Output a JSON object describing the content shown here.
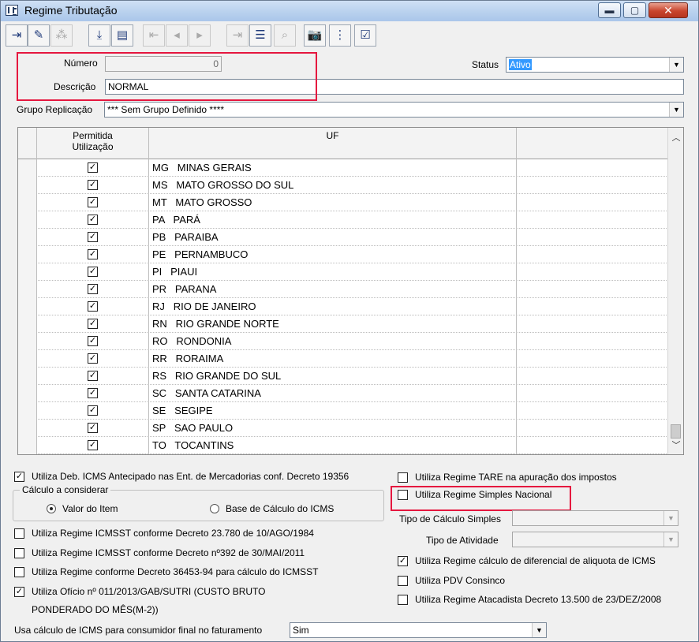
{
  "window": {
    "title": "Regime Tributação",
    "minimize": "▬",
    "maximize": "▢",
    "close": "✕"
  },
  "toolbar": {
    "buttons": [
      {
        "name": "exit-icon",
        "glyph": "⇥",
        "enabled": true
      },
      {
        "name": "eraser-icon",
        "glyph": "✎",
        "enabled": true
      },
      {
        "name": "sitemap-icon",
        "glyph": "⁂",
        "enabled": false
      },
      {
        "name": "save-icon",
        "glyph": "⤓",
        "enabled": true
      },
      {
        "name": "delete-icon",
        "glyph": "▤",
        "enabled": true
      },
      {
        "name": "first-record-icon",
        "glyph": "⇤",
        "enabled": false
      },
      {
        "name": "previous-record-icon",
        "glyph": "◂",
        "enabled": false
      },
      {
        "name": "next-record-icon",
        "glyph": "▸",
        "enabled": false
      },
      {
        "name": "last-record-icon",
        "glyph": "⇥",
        "enabled": false
      },
      {
        "name": "list-icon",
        "glyph": "☰",
        "enabled": true
      },
      {
        "name": "search-icon",
        "glyph": "⌕",
        "enabled": false
      },
      {
        "name": "camera-icon",
        "glyph": "📷",
        "enabled": true
      },
      {
        "name": "tree-icon",
        "glyph": "⋮",
        "enabled": true
      },
      {
        "name": "checklist-icon",
        "glyph": "☑",
        "enabled": true
      }
    ]
  },
  "form": {
    "numero_label": "Número",
    "numero_value": "0",
    "descricao_label": "Descrição",
    "descricao_value": "NORMAL",
    "status_label": "Status",
    "status_value": "Ativo",
    "grupo_label": "Grupo Replicação",
    "grupo_value": "*** Sem Grupo Definido ****"
  },
  "grid": {
    "headers": {
      "permitida": "Permitida\nUtilização",
      "uf": "UF"
    },
    "rows": [
      {
        "uf": "MG   MINAS GERAIS",
        "checked": true
      },
      {
        "uf": "MS   MATO GROSSO DO SUL",
        "checked": true
      },
      {
        "uf": "MT   MATO GROSSO",
        "checked": true
      },
      {
        "uf": "PA   PARÁ",
        "checked": true
      },
      {
        "uf": "PB   PARAIBA",
        "checked": true
      },
      {
        "uf": "PE   PERNAMBUCO",
        "checked": true
      },
      {
        "uf": "PI   PIAUI",
        "checked": true
      },
      {
        "uf": "PR   PARANA",
        "checked": true
      },
      {
        "uf": "RJ   RIO DE JANEIRO",
        "checked": true
      },
      {
        "uf": "RN   RIO GRANDE NORTE",
        "checked": true
      },
      {
        "uf": "RO   RONDONIA",
        "checked": true
      },
      {
        "uf": "RR   RORAIMA",
        "checked": true
      },
      {
        "uf": "RS   RIO GRANDE DO SUL",
        "checked": true
      },
      {
        "uf": "SC   SANTA CATARINA",
        "checked": true
      },
      {
        "uf": "SE   SEGIPE",
        "checked": true
      },
      {
        "uf": "SP   SAO PAULO",
        "checked": true
      },
      {
        "uf": "TO   TOCANTINS",
        "checked": true
      }
    ]
  },
  "options_left": {
    "deb_icms": {
      "label": "Utiliza Deb. ICMS Antecipado nas Ent. de Mercadorias conf. Decreto 19356",
      "checked": true
    },
    "calculo_title": "Cálculo a considerar",
    "radio_valor": "Valor do Item",
    "radio_base": "Base de Cálculo do ICMS",
    "icmsst_23780": {
      "label": "Utiliza Regime ICMSST conforme Decreto 23.780 de 10/AGO/1984",
      "checked": false
    },
    "icmsst_392": {
      "label": "Utiliza Regime ICMSST conforme Decreto nº392 de 30/MAI/2011",
      "checked": false
    },
    "decreto_36453": {
      "label": "Utiliza Regime conforme Decreto 36453-94 para cálculo do ICMSST",
      "checked": false
    },
    "oficio": {
      "label_line1": "Utiliza Ofício nº 011/2013/GAB/SUTRI (CUSTO BRUTO",
      "label_line2": "PONDERADO DO MÊS(M-2))",
      "checked": true
    },
    "consumidor_label": "Usa cálculo de ICMS para consumidor final no faturamento",
    "consumidor_value": "Sim"
  },
  "options_right": {
    "tare": {
      "label": "Utiliza Regime TARE na apuração dos impostos",
      "checked": false
    },
    "simples": {
      "label": "Utiliza Regime Simples Nacional",
      "checked": false
    },
    "tipo_calculo_label": "Tipo de Cálculo Simples",
    "tipo_atividade_label": "Tipo de Atividade",
    "diferencial": {
      "label": "Utiliza Regime cálculo de diferencial de aliquota de ICMS",
      "checked": true
    },
    "pdv": {
      "label": "Utiliza PDV Consinco",
      "checked": false
    },
    "atacadista": {
      "label": "Utiliza Regime Atacadista Decreto 13.500 de 23/DEZ/2008",
      "checked": false
    }
  },
  "colors": {
    "highlight_red": "#e5173f",
    "selection_blue": "#3399ff"
  }
}
